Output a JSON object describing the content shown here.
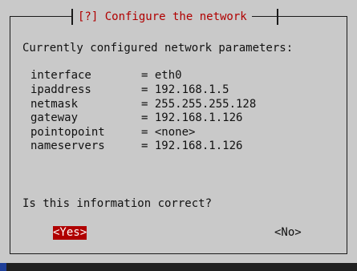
{
  "dialog": {
    "title": "[?] Configure the network",
    "intro": "Currently configured network parameters:",
    "parameters": [
      {
        "name": "interface",
        "value": "= eth0"
      },
      {
        "name": "ipaddress",
        "value": "= 192.168.1.5"
      },
      {
        "name": "netmask",
        "value": "= 255.255.255.128"
      },
      {
        "name": "gateway",
        "value": "= 192.168.1.126"
      },
      {
        "name": "pointopoint",
        "value": "= <none>"
      },
      {
        "name": "nameservers",
        "value": "= 192.168.1.126"
      }
    ],
    "question": "Is this information correct?",
    "yes_label": "<Yes>",
    "no_label": "<No>"
  },
  "colors": {
    "background": "#1f3f98",
    "dialog": "#c9c9c9",
    "accent": "#b00000"
  }
}
